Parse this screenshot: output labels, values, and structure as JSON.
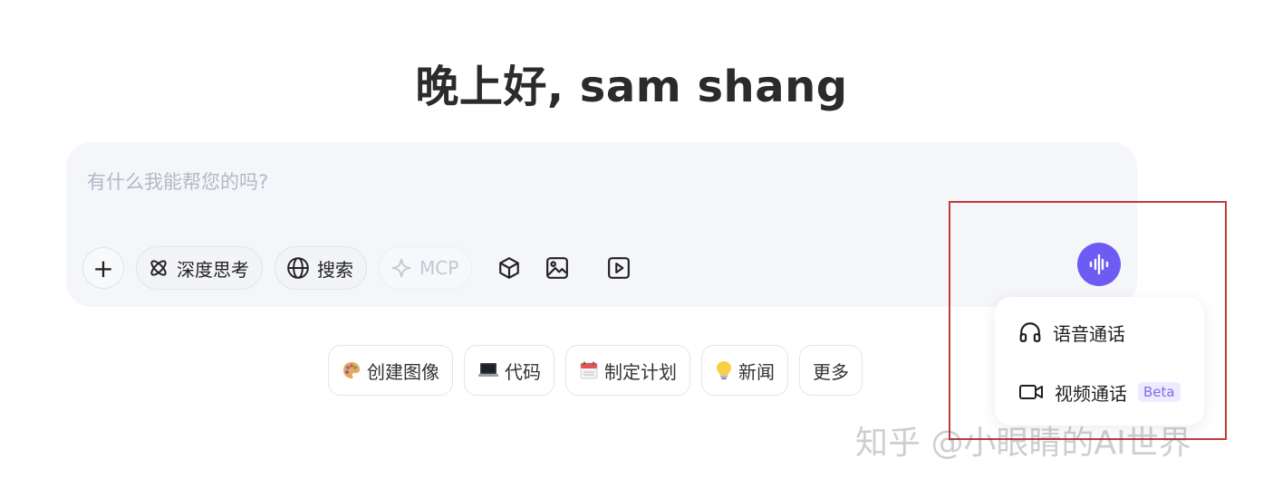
{
  "greeting": "晚上好, sam shang",
  "composer": {
    "placeholder": "有什么我能帮您的吗?",
    "tools": {
      "add_label": "+",
      "deep_think": "深度思考",
      "search": "搜索",
      "mcp": "MCP"
    },
    "icons": [
      "plus-icon",
      "atom-icon",
      "globe-icon",
      "sparkle-icon",
      "cube-icon",
      "image-icon",
      "video-play-icon",
      "voice-wave-icon"
    ],
    "accent_color": "#6d5cf3"
  },
  "suggestions": [
    {
      "emoji": "palette-icon",
      "label": "创建图像"
    },
    {
      "emoji": "laptop-icon",
      "label": "代码"
    },
    {
      "emoji": "calendar-icon",
      "label": "制定计划"
    },
    {
      "emoji": "lightbulb-icon",
      "label": "新闻"
    },
    {
      "emoji": "",
      "label": "更多"
    }
  ],
  "call_menu": {
    "voice_call": "语音通话",
    "video_call": "视频通话",
    "beta_badge": "Beta"
  },
  "watermark": "知乎 @小眼睛的AI世界",
  "annotation_color": "#c33a3a"
}
